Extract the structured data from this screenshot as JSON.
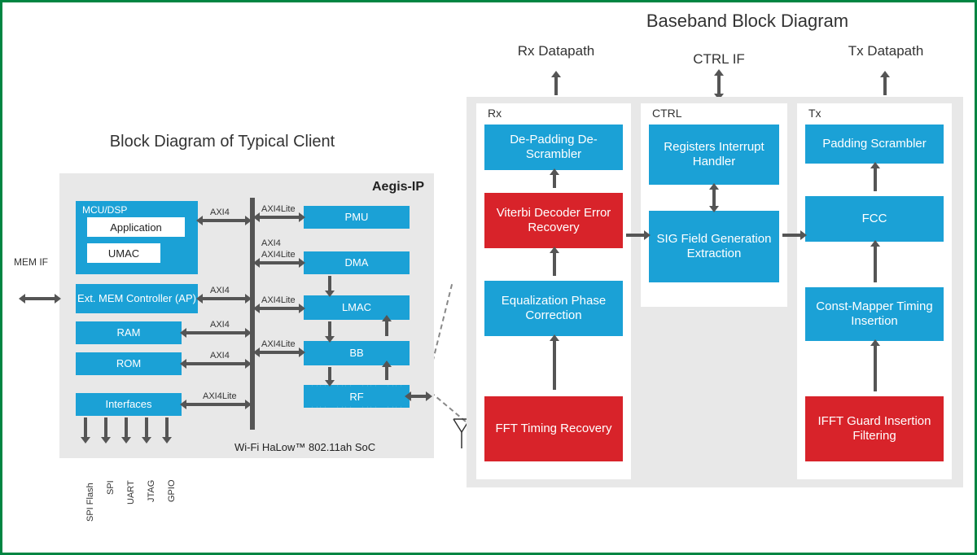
{
  "titles": {
    "baseband": "Baseband Block Diagram",
    "client": "Block Diagram of Typical Client"
  },
  "client": {
    "aegis": "Aegis-IP",
    "soc": "Wi-Fi HaLow™ 802.11ah SoC",
    "mcu": "MCU/DSP",
    "application": "Application",
    "umac": "UMAC",
    "ext_mem": "Ext. MEM Controller (AP)",
    "ram": "RAM",
    "rom": "ROM",
    "interfaces": "Interfaces",
    "pmu": "PMU",
    "dma": "DMA",
    "lmac": "LMAC",
    "bb": "BB",
    "rf": "RF",
    "mem_if": "MEM IF",
    "bus": {
      "axi4": "AXI4",
      "axi4lite": "AXI4Lite"
    },
    "if_ports": [
      "SPI Flash",
      "SPI",
      "UART",
      "JTAG",
      "GPIO"
    ]
  },
  "baseband": {
    "headers": {
      "rx": "Rx Datapath",
      "ctrl": "CTRL IF",
      "tx": "Tx Datapath"
    },
    "cols": {
      "rx": "Rx",
      "ctrl": "CTRL",
      "tx": "Tx"
    },
    "rx": {
      "depad": "De-Padding De-Scrambler",
      "viterbi": "Viterbi Decoder Error Recovery",
      "eq": "Equalization Phase Correction",
      "fft": "FFT Timing Recovery"
    },
    "ctrl": {
      "regs": "Registers Interrupt Handler",
      "sig": "SIG Field Generation Extraction"
    },
    "tx": {
      "pad": "Padding Scrambler",
      "fcc": "FCC",
      "mapper": "Const-Mapper Timing Insertion",
      "ifft": "IFFT Guard Insertion Filtering"
    }
  }
}
